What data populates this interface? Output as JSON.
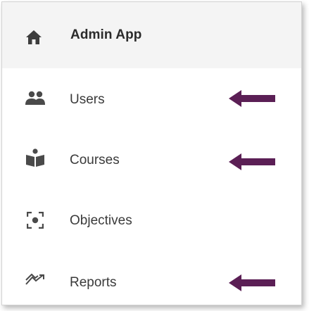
{
  "app": {
    "title": "Admin App",
    "icon": "home-icon"
  },
  "nav": {
    "items": [
      {
        "label": "Users",
        "icon": "users-icon",
        "arrow": true
      },
      {
        "label": "Courses",
        "icon": "courses-icon",
        "arrow": true
      },
      {
        "label": "Objectives",
        "icon": "objectives-icon",
        "arrow": false
      },
      {
        "label": "Reports",
        "icon": "reports-icon",
        "arrow": true
      }
    ]
  },
  "colors": {
    "header_bg": "#f4f4f4",
    "icon": "#4a4a4a",
    "arrow": "#5b1f55",
    "text": "#3a3a3a"
  }
}
